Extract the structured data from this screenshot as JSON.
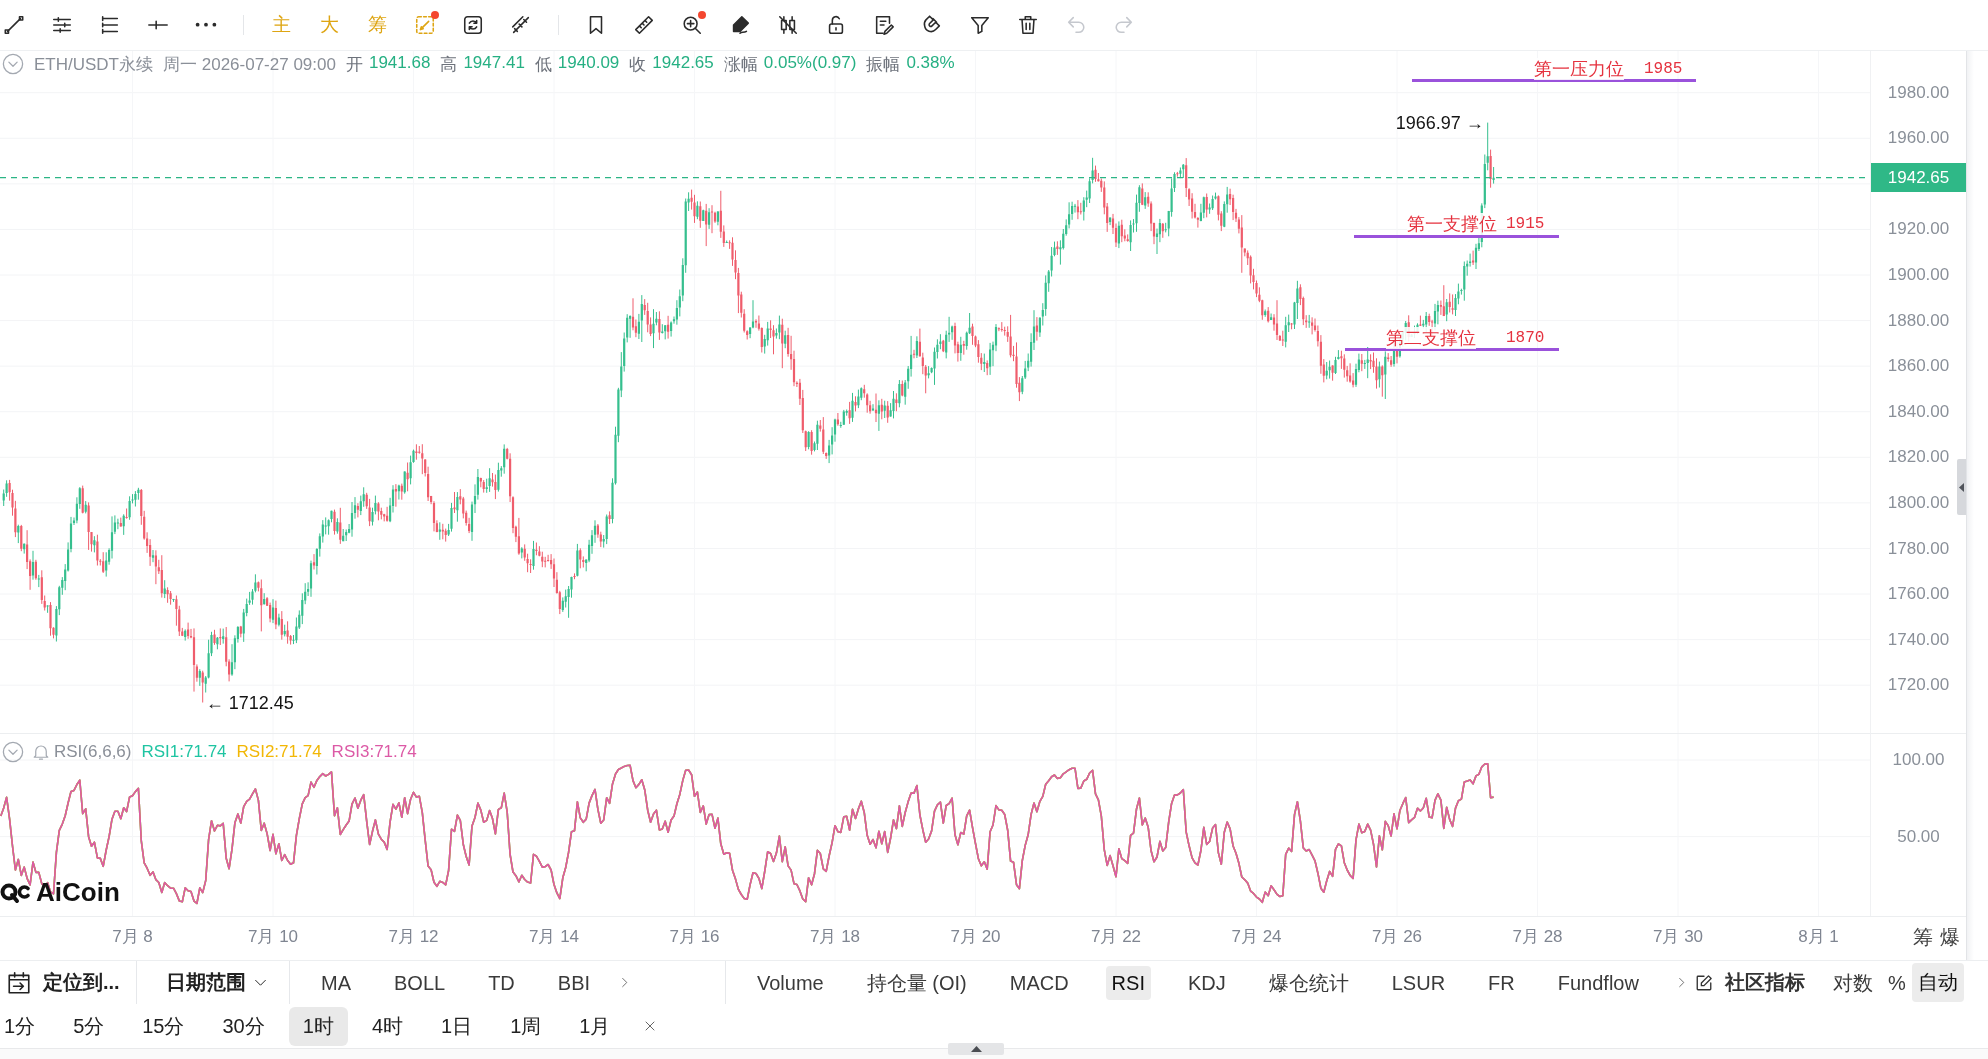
{
  "toolbar": {
    "groups": [
      {
        "items": [
          {
            "kind": "icon",
            "badge": false,
            "disabled": false
          },
          {
            "kind": "icon",
            "badge": false,
            "disabled": false
          },
          {
            "kind": "icon",
            "badge": false,
            "disabled": false
          },
          {
            "kind": "icon",
            "badge": false,
            "disabled": false
          },
          {
            "kind": "icon",
            "badge": false,
            "disabled": false
          }
        ]
      },
      {
        "items": [
          {
            "kind": "text",
            "label": "主",
            "badge": false,
            "disabled": false
          },
          {
            "kind": "text",
            "label": "大",
            "badge": false,
            "disabled": false
          },
          {
            "kind": "text",
            "label": "筹",
            "badge": false,
            "disabled": false
          },
          {
            "kind": "icon",
            "badge": true,
            "disabled": false
          },
          {
            "kind": "icon",
            "badge": false,
            "disabled": false
          },
          {
            "kind": "icon",
            "badge": false,
            "disabled": false
          }
        ]
      },
      {
        "items": [
          {
            "kind": "icon",
            "badge": false,
            "disabled": false
          },
          {
            "kind": "icon",
            "badge": false,
            "disabled": false
          },
          {
            "kind": "icon",
            "badge": true,
            "disabled": false
          },
          {
            "kind": "icon",
            "badge": false,
            "disabled": false
          },
          {
            "kind": "icon",
            "badge": false,
            "disabled": false
          },
          {
            "kind": "icon",
            "badge": false,
            "disabled": false
          },
          {
            "kind": "icon",
            "badge": false,
            "disabled": false
          },
          {
            "kind": "icon",
            "badge": false,
            "disabled": false
          },
          {
            "kind": "icon",
            "badge": false,
            "disabled": false
          },
          {
            "kind": "icon",
            "badge": false,
            "disabled": false
          },
          {
            "kind": "icon",
            "badge": false,
            "disabled": true
          },
          {
            "kind": "icon",
            "badge": false,
            "disabled": true
          }
        ]
      }
    ]
  },
  "main_chart": {
    "symbol": "ETH/USDT永续",
    "datetime": "周一 2026-07-27 09:00",
    "quote": [
      {
        "label": "开",
        "value": "1941.68"
      },
      {
        "label": "高",
        "value": "1947.41"
      },
      {
        "label": "低",
        "value": "1940.09"
      },
      {
        "label": "收",
        "value": "1942.65"
      },
      {
        "label": "涨幅",
        "value": "0.05%(0.97)"
      },
      {
        "label": "振幅",
        "value": "0.38%"
      }
    ],
    "price_axis": [
      "1980.00",
      "1960.00",
      "1920.00",
      "1900.00",
      "1880.00",
      "1860.00",
      "1840.00",
      "1820.00",
      "1800.00",
      "1780.00",
      "1760.00",
      "1740.00",
      "1720.00"
    ],
    "current_price": "1942.65",
    "high_marker": "1966.97 →",
    "low_marker": "← 1712.45",
    "levels": [
      {
        "label": "第一压力位",
        "value": "1985"
      },
      {
        "label": "第一支撑位",
        "value": "1915"
      },
      {
        "label": "第二支撑位",
        "value": "1870"
      }
    ]
  },
  "rsi_panel": {
    "title": "RSI(6,6,6)",
    "lines": [
      {
        "label": "RSI1:71.74",
        "color": "#1fc4a2"
      },
      {
        "label": "RSI2:71.74",
        "color": "#f2b705"
      },
      {
        "label": "RSI3:71.74",
        "color": "#dc5aa6"
      }
    ],
    "axis": [
      "100.00",
      "50.00"
    ],
    "logo_text": "AiCoin"
  },
  "time_axis": {
    "labels": [
      "7月 8",
      "7月 10",
      "7月 12",
      "7月 14",
      "7月 16",
      "7月 18",
      "7月 20",
      "7月 22",
      "7月 24",
      "7月 26",
      "7月 28",
      "7月 30",
      "8月 1"
    ],
    "buttons": [
      "筹",
      "爆"
    ]
  },
  "indicator_bar": {
    "locate": "定位到...",
    "date_range": "日期范围",
    "main_indicators": [
      {
        "label": "MA",
        "selected": false
      },
      {
        "label": "BOLL",
        "selected": false
      },
      {
        "label": "TD",
        "selected": false
      },
      {
        "label": "BBI",
        "selected": false
      }
    ],
    "sub_indicators": [
      {
        "label": "Volume",
        "selected": false
      },
      {
        "label": "持仓量 (OI)",
        "selected": false
      },
      {
        "label": "MACD",
        "selected": false
      },
      {
        "label": "RSI",
        "selected": true
      },
      {
        "label": "KDJ",
        "selected": false
      },
      {
        "label": "爆仓统计",
        "selected": false
      },
      {
        "label": "LSUR",
        "selected": false
      },
      {
        "label": "FR",
        "selected": false
      },
      {
        "label": "Fundflow",
        "selected": false
      }
    ],
    "community": "社区指标",
    "scale_options": [
      {
        "label": "对数",
        "selected": false
      },
      {
        "label": "%",
        "selected": false
      },
      {
        "label": "自动",
        "selected": true
      }
    ]
  },
  "intervals": [
    {
      "label": "1分",
      "selected": false
    },
    {
      "label": "5分",
      "selected": false
    },
    {
      "label": "15分",
      "selected": false
    },
    {
      "label": "30分",
      "selected": false
    },
    {
      "label": "1时",
      "selected": true
    },
    {
      "label": "4时",
      "selected": false
    },
    {
      "label": "1日",
      "selected": false
    },
    {
      "label": "1周",
      "selected": false
    },
    {
      "label": "1月",
      "selected": false
    }
  ]
}
